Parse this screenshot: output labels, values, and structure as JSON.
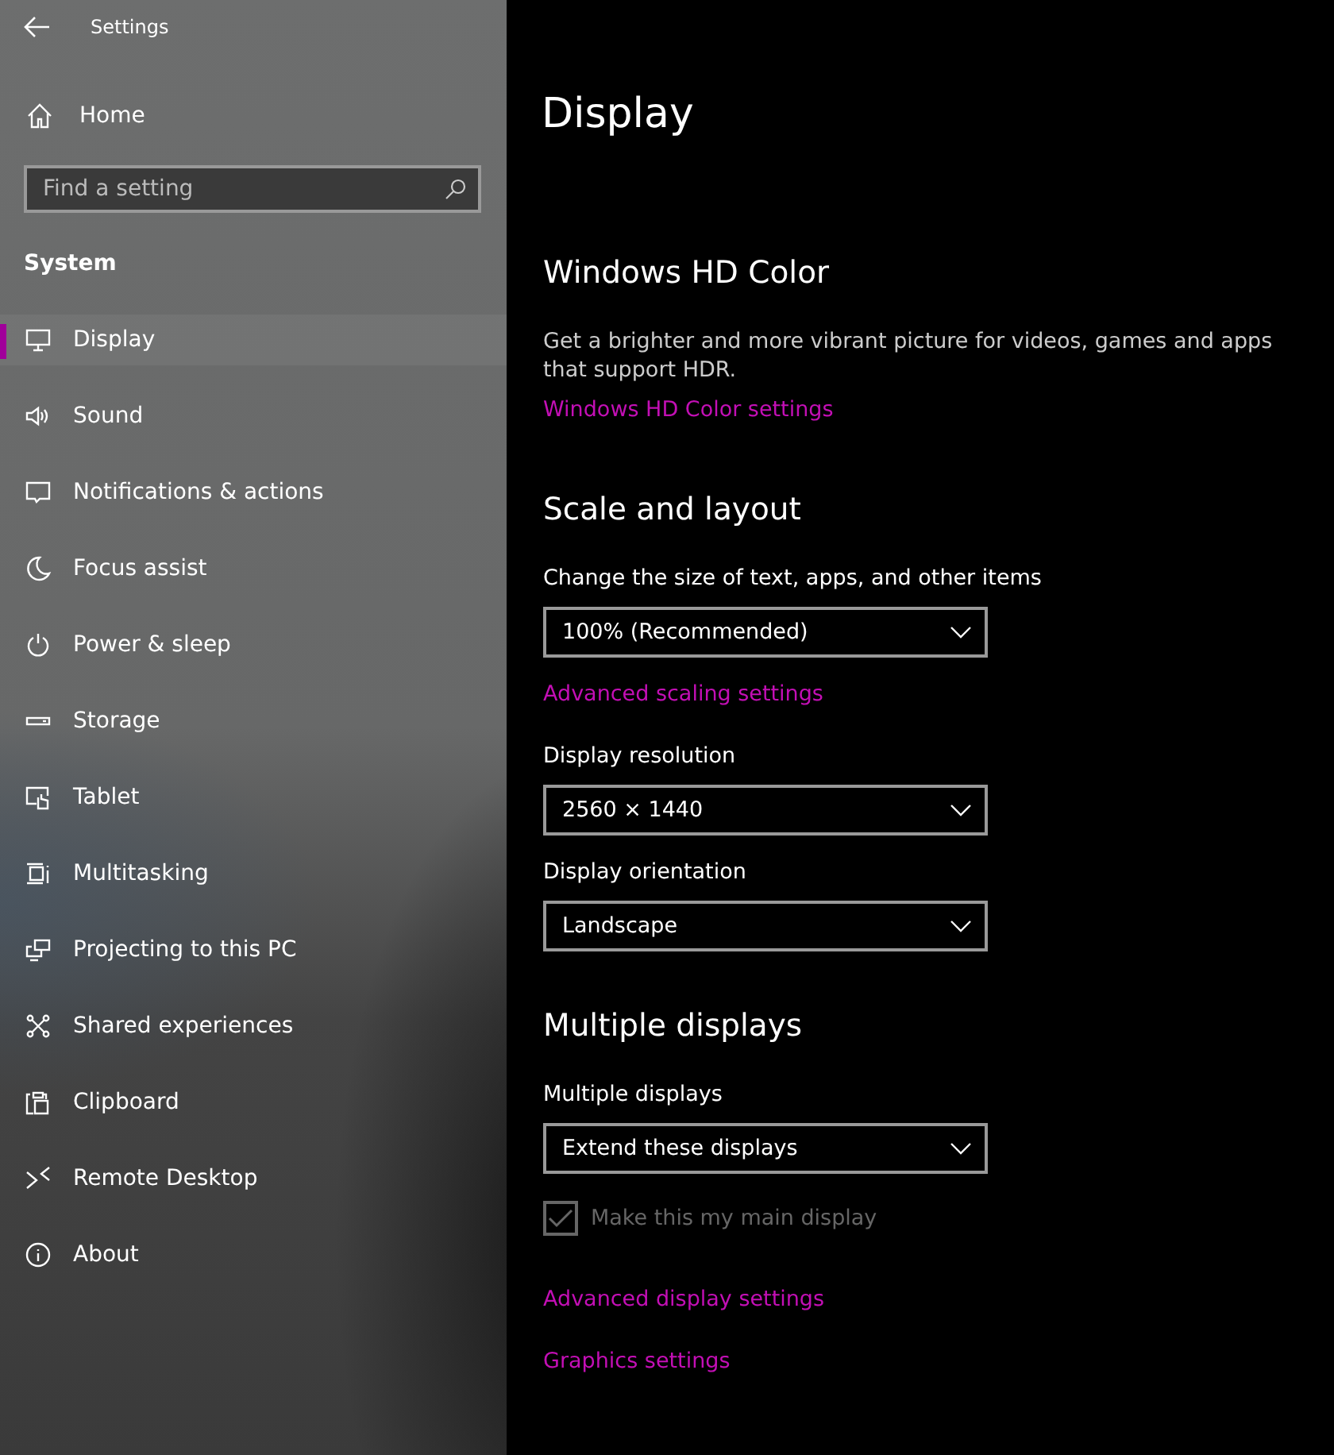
{
  "window": {
    "title": "Settings"
  },
  "nav": {
    "home": "Home",
    "search": {
      "placeholder": "Find a setting"
    },
    "section": "System",
    "items": [
      {
        "label": "Display",
        "selected": true
      },
      {
        "label": "Sound",
        "selected": false
      },
      {
        "label": "Notifications & actions",
        "selected": false
      },
      {
        "label": "Focus assist",
        "selected": false
      },
      {
        "label": "Power & sleep",
        "selected": false
      },
      {
        "label": "Storage",
        "selected": false
      },
      {
        "label": "Tablet",
        "selected": false
      },
      {
        "label": "Multitasking",
        "selected": false
      },
      {
        "label": "Projecting to this PC",
        "selected": false
      },
      {
        "label": "Shared experiences",
        "selected": false
      },
      {
        "label": "Clipboard",
        "selected": false
      },
      {
        "label": "Remote Desktop",
        "selected": false
      },
      {
        "label": "About",
        "selected": false
      }
    ]
  },
  "page": {
    "title": "Display",
    "blocks": [
      {
        "kind": "heading",
        "text": "Windows HD Color"
      },
      {
        "kind": "text",
        "text": "Get a brighter and more vibrant picture for videos, games and apps that support HDR."
      },
      {
        "kind": "link",
        "text": "Windows HD Color settings"
      },
      {
        "kind": "heading",
        "text": "Scale and layout"
      },
      {
        "kind": "label",
        "text": "Change the size of text, apps, and other items"
      },
      {
        "kind": "dropdown",
        "value": "100% (Recommended)"
      },
      {
        "kind": "link",
        "text": "Advanced scaling settings"
      },
      {
        "kind": "label",
        "text": "Display resolution"
      },
      {
        "kind": "dropdown",
        "value": "2560 × 1440"
      },
      {
        "kind": "label",
        "text": "Display orientation"
      },
      {
        "kind": "dropdown",
        "value": "Landscape"
      },
      {
        "kind": "heading",
        "text": "Multiple displays"
      },
      {
        "kind": "label",
        "text": "Multiple displays"
      },
      {
        "kind": "dropdown",
        "value": "Extend these displays"
      },
      {
        "kind": "checkbox",
        "text": "Make this my main display",
        "checked": true,
        "disabled": true
      },
      {
        "kind": "link",
        "text": "Advanced display settings"
      },
      {
        "kind": "link",
        "text": "Graphics settings"
      }
    ]
  }
}
